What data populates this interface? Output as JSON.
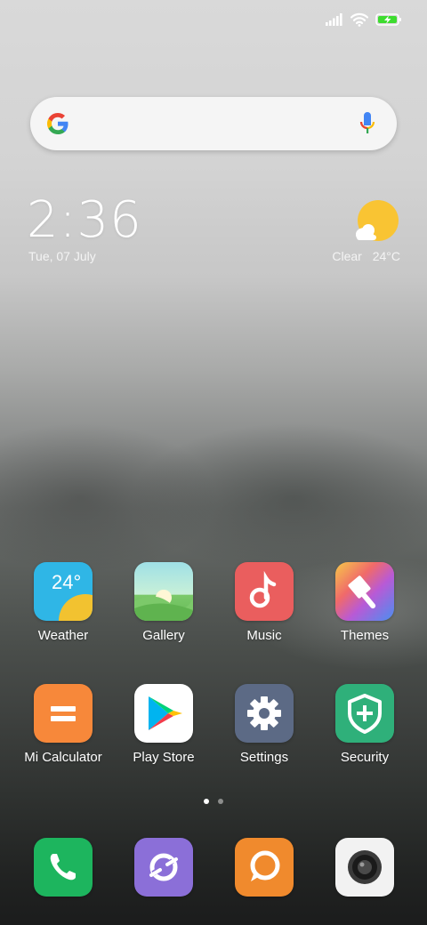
{
  "status_bar": {
    "icons": [
      "signal-icon",
      "wifi-icon",
      "battery-charging-icon"
    ],
    "battery_color": "#3ddc2f"
  },
  "search": {
    "logo": "google-logo",
    "mic_icon": "mic-icon"
  },
  "clock_widget": {
    "time": "2:36",
    "date": "Tue, 07 July"
  },
  "weather_widget": {
    "icon": "partly-sunny-icon",
    "condition": "Clear",
    "temperature": "24°C"
  },
  "home_apps": [
    {
      "label": "Weather",
      "icon": "weather-icon",
      "badge": "24°"
    },
    {
      "label": "Gallery",
      "icon": "gallery-icon"
    },
    {
      "label": "Music",
      "icon": "music-icon"
    },
    {
      "label": "Themes",
      "icon": "themes-icon"
    },
    {
      "label": "Mi Calculator",
      "icon": "calculator-icon"
    },
    {
      "label": "Play Store",
      "icon": "play-store-icon"
    },
    {
      "label": "Settings",
      "icon": "settings-icon"
    },
    {
      "label": "Security",
      "icon": "security-icon"
    }
  ],
  "page_indicator": {
    "pages": 2,
    "current": 1
  },
  "dock": [
    {
      "icon": "phone-icon"
    },
    {
      "icon": "browser-icon"
    },
    {
      "icon": "messaging-icon"
    },
    {
      "icon": "camera-icon"
    }
  ]
}
